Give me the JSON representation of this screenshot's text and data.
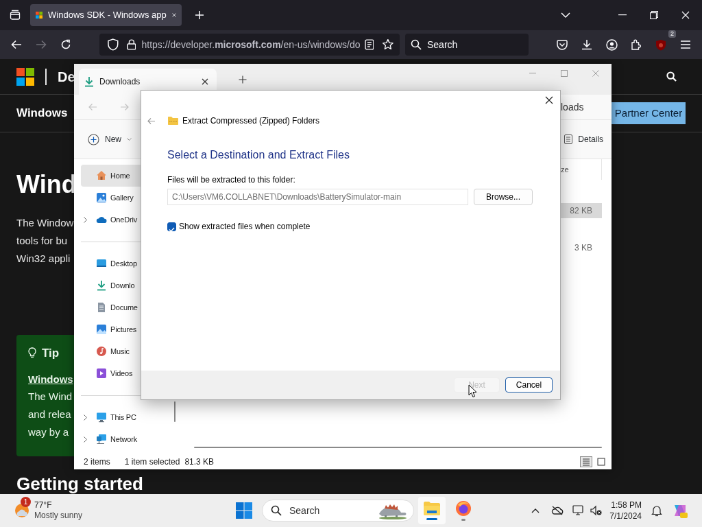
{
  "browser": {
    "tab": {
      "title": "Windows SDK - Windows app",
      "selected": true
    },
    "url": "https://developer.**microsoft.com**/en-us/windows/do",
    "forward_disabled": true,
    "search": {
      "placeholder": "Search"
    },
    "extension_badge": "2"
  },
  "page": {
    "brand": "De",
    "section_title": "Windows",
    "partner_button": "Partner Center",
    "heading": "Wind",
    "intro": [
      "The Window",
      "tools for bu",
      "Win32 appli"
    ],
    "tip": {
      "title": "Tip",
      "link": "Windows",
      "lines": [
        "The Wind",
        "and relea",
        "way by a"
      ]
    },
    "next_heading": "Getting started"
  },
  "explorer": {
    "tab_title": "Downloads",
    "breadcrumb": "loads",
    "new_button": "New",
    "details_button": "Details",
    "sidebar": [
      {
        "items": [
          {
            "label": "Home",
            "kind": "home",
            "expandable": false,
            "selected": true
          },
          {
            "label": "Gallery",
            "kind": "gallery",
            "expandable": false,
            "selected": false
          },
          {
            "label": "OneDriv",
            "kind": "cloud",
            "expandable": true,
            "selected": false
          }
        ]
      },
      {
        "items": [
          {
            "label": "Desktop",
            "kind": "desktop",
            "expandable": false,
            "selected": false
          },
          {
            "label": "Downlo",
            "kind": "download",
            "expandable": false,
            "selected": false
          },
          {
            "label": "Docume",
            "kind": "document",
            "expandable": false,
            "selected": false
          },
          {
            "label": "Pictures",
            "kind": "pictures",
            "expandable": false,
            "selected": false
          },
          {
            "label": "Music",
            "kind": "music",
            "expandable": false,
            "selected": false
          },
          {
            "label": "Videos",
            "kind": "video",
            "expandable": false,
            "selected": false
          }
        ]
      },
      {
        "items": [
          {
            "label": "This PC",
            "kind": "pc",
            "expandable": true,
            "selected": false
          },
          {
            "label": "Network",
            "kind": "network",
            "expandable": true,
            "selected": false
          }
        ]
      }
    ],
    "column_header": "ze",
    "rows": [
      {
        "size": "82 KB",
        "selected": true
      },
      {
        "size": "3 KB",
        "selected": false
      }
    ],
    "status": {
      "count": "2 items",
      "selection": "1 item selected",
      "size": "81.3 KB"
    },
    "views": [
      {
        "kind": "details",
        "selected": true
      },
      {
        "kind": "tiles",
        "selected": false
      }
    ]
  },
  "dialog": {
    "title": "Extract Compressed (Zipped) Folders",
    "heading": "Select a Destination and Extract Files",
    "label": "Files will be extracted to this folder:",
    "path": "C:\\Users\\VM6.COLLABNET\\Downloads\\BatterySimulator-main",
    "browse": "Browse...",
    "option": {
      "label": "Show extracted files when complete",
      "checked": true
    },
    "buttons": [
      {
        "label": "Next",
        "disabled": true
      },
      {
        "label": "Cancel",
        "disabled": false
      }
    ]
  },
  "taskbar": {
    "weather": {
      "badge": "1",
      "temperature": "77°F",
      "condition": "Mostly sunny"
    },
    "search": {
      "placeholder": "Search"
    },
    "apps": [
      {
        "kind": "explorer",
        "active": true
      },
      {
        "kind": "firefox",
        "active": false
      }
    ],
    "time": "1:58 PM",
    "date": "7/1/2024"
  }
}
